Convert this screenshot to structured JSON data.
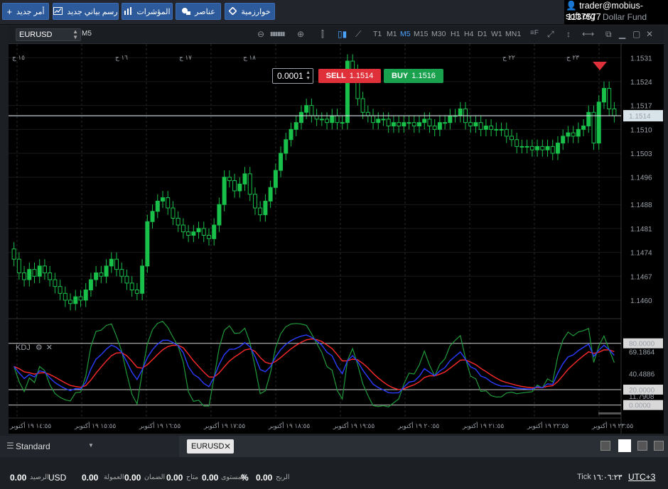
{
  "toolbar": {
    "buttons": [
      {
        "label": "أمر جديد",
        "icon": "+"
      },
      {
        "label": "رسم بياني جديد",
        "icon": "chart"
      },
      {
        "label": "المؤشرات",
        "icon": "bars"
      },
      {
        "label": "عناصر",
        "icon": "shapes"
      },
      {
        "label": "خوارزمية",
        "icon": "diamond"
      }
    ]
  },
  "account": {
    "email": "trader@mobius-soft.org",
    "number": "1137577",
    "name": "Dollar Fund"
  },
  "chart_toolbar": {
    "symbol": "EURUSD",
    "timeframe_label": "M5",
    "timeframes": [
      "T1",
      "M1",
      "M5",
      "M15",
      "M30",
      "H1",
      "H4",
      "D1",
      "W1",
      "MN1"
    ],
    "active_timeframe": "M5"
  },
  "trade": {
    "quantity": "0.0001",
    "sell_label": "SELL",
    "sell_price": "1.1514",
    "buy_label": "BUY",
    "buy_price": "1.1516"
  },
  "chart_data": {
    "type": "candlestick",
    "symbol": "EURUSD",
    "current_price": 1.1514,
    "price_axis_labels": [
      1.1531,
      1.1524,
      1.1517,
      1.151,
      1.1503,
      1.1496,
      1.1488,
      1.1481,
      1.1474,
      1.1467,
      1.146
    ],
    "ylim": [
      1.1455,
      1.1535
    ],
    "top_day_labels": [
      "١٥ ج",
      "١٦ ج",
      "١٧ ج",
      "١٨ ج",
      "٢٢ ج",
      "٢٣ ج"
    ],
    "x_labels": [
      "١٤:٥٥ ١٩ أكتوبر",
      "١٥:٥٥ ١٩ أكتوبر",
      "١٦:٥٥ ١٩ أكتوبر",
      "١٧:٥٥ ١٩ أكتوبر",
      "١٨:٥٥ ١٩ أكتوبر",
      "١٩:٥٥ ١٩ أكتوبر",
      "٢٠:٥٥ ١٩ أكتوبر",
      "٢١:٥٥ ١٩ أكتوبر",
      "٢٢:٥٥ ١٩ أكتوبر",
      "٢٣:٥٥ ١٩ أكتوبر"
    ],
    "close": [
      1.1472,
      1.1468,
      1.1466,
      1.1469,
      1.1467,
      1.147,
      1.1468,
      1.1466,
      1.1464,
      1.1462,
      1.146,
      1.1459,
      1.1461,
      1.146,
      1.1463,
      1.1466,
      1.1468,
      1.1467,
      1.147,
      1.1472,
      1.1469,
      1.1467,
      1.1465,
      1.1463,
      1.1462,
      1.147,
      1.1483,
      1.1486,
      1.1489,
      1.149,
      1.1487,
      1.1484,
      1.1482,
      1.148,
      1.1479,
      1.148,
      1.1481,
      1.1479,
      1.1478,
      1.1482,
      1.1488,
      1.1496,
      1.1495,
      1.1492,
      1.1494,
      1.1497,
      1.1491,
      1.1487,
      1.1485,
      1.1489,
      1.1493,
      1.1498,
      1.1503,
      1.1507,
      1.151,
      1.1512,
      1.1515,
      1.1517,
      1.1514,
      1.1513,
      1.1513,
      1.1512,
      1.1514,
      1.1512,
      1.1512,
      1.153,
      1.1527,
      1.1519,
      1.1515,
      1.1514,
      1.1512,
      1.1513,
      1.1513,
      1.1511,
      1.1512,
      1.1511,
      1.1512,
      1.1512,
      1.1511,
      1.1512,
      1.1513,
      1.1511,
      1.151,
      1.1512,
      1.1512,
      1.1514,
      1.1514,
      1.1516,
      1.1512,
      1.1511,
      1.1512,
      1.151,
      1.1511,
      1.151,
      1.151,
      1.151,
      1.1508,
      1.1507,
      1.1505,
      1.1505,
      1.1505,
      1.1504,
      1.1505,
      1.1504,
      1.1505,
      1.1503,
      1.1506,
      1.1508,
      1.1509,
      1.1508,
      1.151,
      1.1511,
      1.1515,
      1.1506,
      1.1518,
      1.1522,
      1.1516,
      1.1514
    ],
    "kdj": {
      "levels": [
        80.0,
        20.0,
        0.0
      ],
      "axis_labels": [
        80.0,
        69.1864,
        40.4886,
        20.0,
        11.7908,
        0.0
      ],
      "series": [
        {
          "name": "K",
          "color": "#2a3cff"
        },
        {
          "name": "D",
          "color": "#ff2a2a"
        },
        {
          "name": "J",
          "color": "#1f9a3a"
        }
      ]
    }
  },
  "indicator": {
    "name": "KDJ"
  },
  "bottom": {
    "layout_name": "Standard",
    "tab_label": "EURUSD"
  },
  "status": {
    "balance_label": "الرصيد",
    "balance": "0.00",
    "currency": "USD",
    "credit_label": "العمولة",
    "credit": "0.00",
    "equity_label": "الضمان",
    "equity": "0.00",
    "margin_label": "متاح",
    "margin": "0.00",
    "level_label": "المستوى",
    "level": "%",
    "profit_label": "الربح",
    "profit": "0.00",
    "tick_label": "Tick",
    "time": "١٦:٠٦:٢٣",
    "timezone": "UTC+3"
  }
}
